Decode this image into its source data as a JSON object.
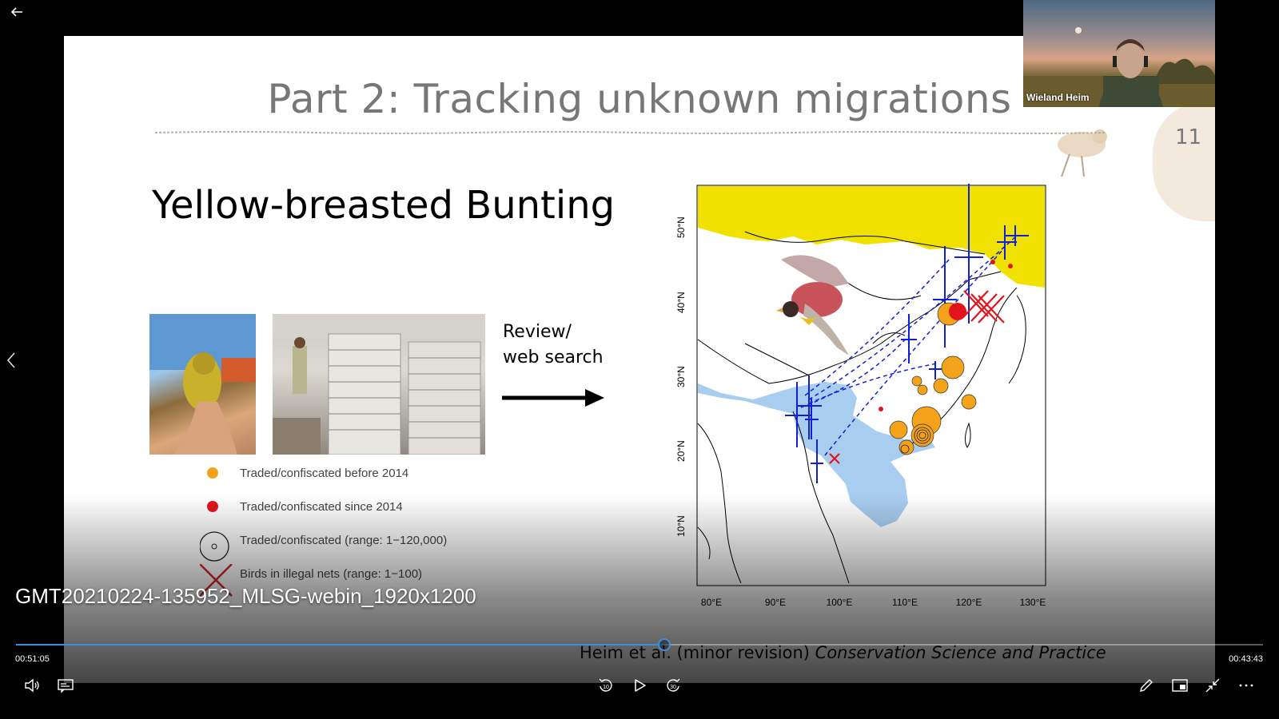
{
  "slide": {
    "title": "Part 2: Tracking unknown migrations",
    "number": "11",
    "subheading": "Yellow-breasted Bunting",
    "review_line1": "Review/",
    "review_line2": "web search",
    "legend": [
      {
        "label": "Traded/confiscated before 2014",
        "color": "#f5a21b"
      },
      {
        "label": "Traded/confiscated since 2014",
        "color": "#e4141b"
      },
      {
        "label": "Traded/confiscated (range: 1−120,000)",
        "color": "#000000"
      },
      {
        "label": "Birds in illegal nets (range: 1−100)",
        "color": "#d0262b"
      }
    ],
    "citation_plain": "Heim et al. (minor revision) ",
    "citation_italic": "Conservation Science and Practice"
  },
  "map": {
    "lat_labels": [
      "50°N",
      "40°N",
      "30°N",
      "20°N",
      "10°N"
    ],
    "lon_labels": [
      "80°E",
      "90°E",
      "100°E",
      "110°E",
      "120°E",
      "130°E"
    ],
    "colors": {
      "breeding": "#f0e100",
      "wintering": "#a9cdef",
      "tracks": "#1020d8",
      "pre2014": "#f5a21b",
      "post2014": "#e4141b"
    }
  },
  "webcam": {
    "name": "Wieland Heim"
  },
  "player": {
    "file_title": "GMT20210224-135952_MLSG-webin_1920x1200",
    "time_elapsed": "00:51:05",
    "time_remaining": "00:43:43",
    "progress_fraction": 0.52,
    "rewind_label": "10",
    "forward_label": "30"
  },
  "icons": [
    "back-arrow-icon",
    "chevron-left-icon",
    "volume-icon",
    "captions-icon",
    "rewind-10-icon",
    "play-icon",
    "forward-30-icon",
    "pen-icon",
    "picture-in-picture-icon",
    "exit-fullscreen-icon",
    "more-icon"
  ]
}
